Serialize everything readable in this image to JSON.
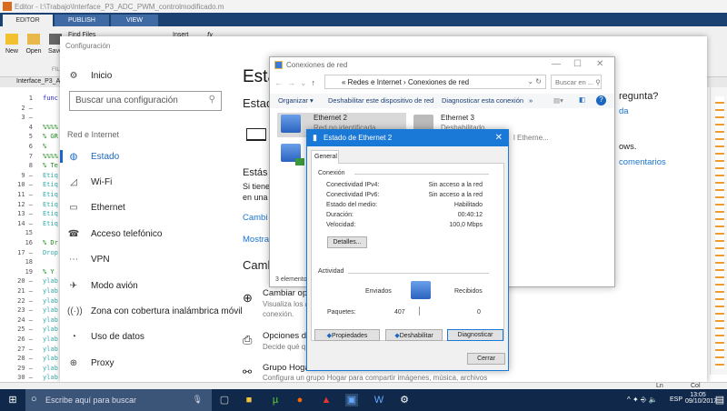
{
  "matlab": {
    "title": "Editor - I:\\Trabajo\\Interface_P3_ADC_PWM_controlmodificado.m",
    "tabs": [
      "EDITOR",
      "PUBLISH",
      "VIEW"
    ],
    "toolbar": {
      "new": "New",
      "open": "Open",
      "save": "Save",
      "find_files": "Find Files",
      "insert": "Insert",
      "fx": "fx",
      "file_section": "FILE"
    },
    "file_tab": "Interface_P3_ADC",
    "lines": [
      [
        "1",
        "",
        "func"
      ],
      [
        "2 –",
        "",
        ""
      ],
      [
        "3 –",
        "",
        ""
      ],
      [
        "4",
        "",
        "%%%%"
      ],
      [
        "5",
        "",
        "% GR"
      ],
      [
        "6",
        "",
        "%"
      ],
      [
        "7",
        "",
        "%%%%"
      ],
      [
        "8",
        "",
        "% Te"
      ],
      [
        "9 –",
        "",
        "Etiq"
      ],
      [
        "10 –",
        "",
        "Etiq"
      ],
      [
        "11 –",
        "",
        "Etiq"
      ],
      [
        "12 –",
        "",
        "Etiq"
      ],
      [
        "13 –",
        "",
        "Etiq"
      ],
      [
        "14 –",
        "",
        "Etiq"
      ],
      [
        "15",
        "",
        ""
      ],
      [
        "16",
        "",
        "% Dr"
      ],
      [
        "17 –",
        "",
        "Drop"
      ],
      [
        "18",
        "",
        ""
      ],
      [
        "19",
        "",
        "% Y"
      ],
      [
        "20 –",
        "",
        "ylab"
      ],
      [
        "21 –",
        "",
        "ylab"
      ],
      [
        "22 –",
        "",
        "ylab"
      ],
      [
        "23 –",
        "",
        "ylab"
      ],
      [
        "24 –",
        "",
        "ylab"
      ],
      [
        "25 –",
        "",
        "ylab"
      ],
      [
        "26 –",
        "",
        "ylab"
      ],
      [
        "27 –",
        "",
        "ylab"
      ],
      [
        "28 –",
        "",
        "ylab"
      ],
      [
        "29 –",
        "",
        "ylab"
      ],
      [
        "30 –",
        "",
        "ylab"
      ]
    ],
    "status": {
      "ln": "Ln",
      "col": "Col"
    }
  },
  "settings": {
    "title": "Configuración",
    "home": "Inicio",
    "search_placeholder": "Buscar una configuración",
    "section": "Red e Internet",
    "nav": [
      {
        "label": "Estado",
        "icon": "globe-status-icon"
      },
      {
        "label": "Wi-Fi",
        "icon": "wifi-icon"
      },
      {
        "label": "Ethernet",
        "icon": "ethernet-icon"
      },
      {
        "label": "Acceso telefónico",
        "icon": "dialup-icon"
      },
      {
        "label": "VPN",
        "icon": "vpn-icon"
      },
      {
        "label": "Modo avión",
        "icon": "airplane-icon"
      },
      {
        "label": "Zona con cobertura inalámbrica móvil",
        "icon": "hotspot-icon"
      },
      {
        "label": "Uso de datos",
        "icon": "data-usage-icon"
      },
      {
        "label": "Proxy",
        "icon": "proxy-icon"
      }
    ],
    "main": {
      "h1": "Esta",
      "h2": "Estad",
      "status_title": "Estás",
      "status_l1": "Si tiene",
      "status_l2": "en una",
      "link1": "Cambi",
      "link2": "Mostra",
      "h3": "Camb",
      "opt1_title": "Cambiar opc",
      "opt1_desc1": "Visualiza los a",
      "opt1_desc2": "conexión.",
      "opt2_title": "Opciones de",
      "opt2_desc": "Decide qué q",
      "opt3_title": "Grupo Hogar",
      "opt3_desc": "Configura un grupo Hogar para compartir imágenes, música, archivos"
    },
    "aside": {
      "question": "regunta?",
      "help_link": "da",
      "windows": "ows.",
      "feedback_link": "comentarios"
    }
  },
  "network": {
    "title": "Conexiones de red",
    "breadcrumb": [
      "Redes e Internet",
      "Conexiones de red"
    ],
    "search_placeholder": "Buscar en ...",
    "commands": [
      "Organizar ▾",
      "Deshabilitar este dispositivo de red",
      "Diagnosticar esta conexión",
      "»"
    ],
    "items": [
      {
        "name": "Ethernet 2",
        "status": "Red no identificada"
      },
      {
        "name": "Ethernet 3",
        "status": "Deshabilitado",
        "extra": "l Etherne..."
      }
    ],
    "count": "3 elemento"
  },
  "dialog": {
    "title": "Estado de Ethernet 2",
    "tab": "General",
    "conn_section": "Conexión",
    "rows": [
      {
        "label": "Conectividad IPv4:",
        "value": "Sin acceso a la red"
      },
      {
        "label": "Conectividad IPv6:",
        "value": "Sin acceso a la red"
      },
      {
        "label": "Estado del medio:",
        "value": "Habilitado"
      },
      {
        "label": "Duración:",
        "value": "00:40:12"
      },
      {
        "label": "Velocidad:",
        "value": "100,0 Mbps"
      }
    ],
    "details_btn": "Detalles...",
    "activity_section": "Actividad",
    "sent": "Enviados",
    "received": "Recibidos",
    "packets_label": "Paquetes:",
    "packets_sent": "407",
    "packets_received": "0",
    "btn_properties": "Propiedades",
    "btn_disable": "Deshabilitar",
    "btn_diagnose": "Diagnosticar",
    "btn_close": "Cerrar"
  },
  "taskbar": {
    "search_placeholder": "Escribe aquí para buscar",
    "lang": "ESP",
    "time": "13:05",
    "date": "09/10/2017"
  }
}
